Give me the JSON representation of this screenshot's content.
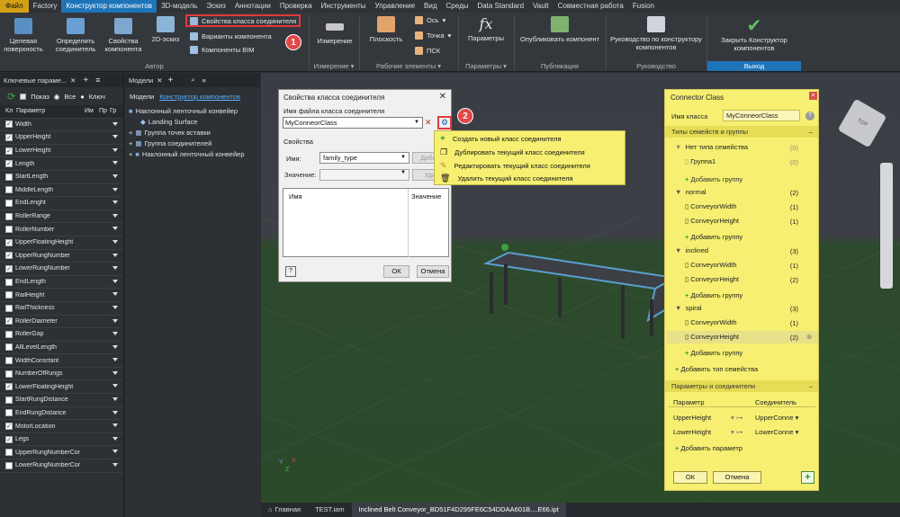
{
  "menubar": {
    "items": [
      "Файл",
      "Factory",
      "Конструктор компонентов",
      "3D-модель",
      "Эскиз",
      "Аннотации",
      "Проверка",
      "Инструменты",
      "Управление",
      "Вид",
      "Среды",
      "Data Standard",
      "Vault",
      "Совместная работа",
      "Fusion"
    ]
  },
  "ribbon": {
    "btn_surface": "Целевая поверхность",
    "btn_define": "Определить соединитель",
    "btn_props": "Свойства компонента",
    "btn_2d": "2D-эскиз",
    "small_connector_props": "Свойства класса соединителя",
    "small_variants": "Варианты компонента",
    "small_bim": "Компоненты BIM",
    "group_author": "Автор",
    "btn_measure": "Измерение",
    "group_measure": "Измерение",
    "btn_plane": "Плоскость",
    "small_axis": "Ось",
    "small_point": "Точка",
    "small_ucs": "ПСК",
    "group_work": "Рабочие элементы",
    "btn_params": "Параметры",
    "group_params": "Параметры",
    "btn_publish": "Опубликовать компонент",
    "group_publish": "Публикация",
    "btn_guide": "Руководство по конструктору компонентов",
    "group_guide": "Руководство",
    "btn_close": "Закрыть Конструктор компонентов",
    "group_exit": "Выход",
    "badge1": "1"
  },
  "left_panel": {
    "title": "Ключевые параме...",
    "show_label": "Показ",
    "radio_all": "Все",
    "radio_key": "Ключ",
    "col_kl": "Кл",
    "col_param": "Параметр",
    "col_im": "Им",
    "col_pr": "Пр",
    "col_gr": "Гр",
    "rows": [
      {
        "name": "Width",
        "checked": true
      },
      {
        "name": "UpperHeight",
        "checked": true
      },
      {
        "name": "LowerHeight",
        "checked": true
      },
      {
        "name": "Length",
        "checked": true
      },
      {
        "name": "StartLength",
        "checked": false
      },
      {
        "name": "MiddleLength",
        "checked": false
      },
      {
        "name": "EndLenght",
        "checked": false
      },
      {
        "name": "RollerRange",
        "checked": false
      },
      {
        "name": "RollerNumber",
        "checked": false
      },
      {
        "name": "UpperFloatingHeight",
        "checked": true
      },
      {
        "name": "UpperRungNumber",
        "checked": true
      },
      {
        "name": "LowerRungNumber",
        "checked": true
      },
      {
        "name": "EndLength",
        "checked": false
      },
      {
        "name": "RailHeight",
        "checked": false
      },
      {
        "name": "RailThickness",
        "checked": false
      },
      {
        "name": "RollerDiameter",
        "checked": true
      },
      {
        "name": "RollerGap",
        "checked": false
      },
      {
        "name": "AllLevelLength",
        "checked": false
      },
      {
        "name": "WidthConsrtant",
        "checked": false
      },
      {
        "name": "NumberOfRungs",
        "checked": false
      },
      {
        "name": "LowerFloatingHeight",
        "checked": true
      },
      {
        "name": "StartRungDistance",
        "checked": false
      },
      {
        "name": "EndRungDistance",
        "checked": false
      },
      {
        "name": "MotorLocation",
        "checked": true
      },
      {
        "name": "Legs",
        "checked": true
      },
      {
        "name": "UpperRungNumberCor",
        "checked": false
      },
      {
        "name": "LowerRungNumberCor",
        "checked": false
      }
    ]
  },
  "browser": {
    "tab_model": "Модели",
    "tab_designer": "Конструктор компонентов",
    "root": "Наклонный ленточный конвейер",
    "n1": "Landing Surface",
    "n2": "Группа точек вставки",
    "n3": "Группа соединителей",
    "n4": "Наклонный ленточный конвейер"
  },
  "dialog": {
    "title": "Свойства класса соединителя",
    "file_label": "Имя файла класса соединителя",
    "file_value": "MyConneorClass",
    "props_label": "Свойства",
    "name_label": "Имя:",
    "name_value": "family_type",
    "value_label": "Значение:",
    "add_btn": "Добави",
    "del_btn": "Удал",
    "col_name": "Имя",
    "col_value": "Значение",
    "ok": "ОК",
    "cancel": "Отмена",
    "badge2": "2"
  },
  "popup": {
    "items": [
      "Создать новый класс соединителя",
      "Дублировать текущий класс соединителя",
      "Редактировать текущий класс соединителя",
      "Удалить текущий класс соединителя"
    ]
  },
  "connector": {
    "title": "Connector Class",
    "class_label": "Имя класса",
    "class_value": "MyConneorClass",
    "sec_types": "Типы семейств и группы",
    "no_type": "Нет типа семейства",
    "no_type_count": "(0)",
    "group1": "Группа1",
    "group1_count": "(0)",
    "add_group": "Добавить группу",
    "normal": "normal",
    "normal_count": "(2)",
    "n_cw": "ConveyorWidth",
    "n_cw_count": "(1)",
    "n_ch": "ConveyorHeight",
    "n_ch_count": "(1)",
    "inclined": "inclined",
    "inclined_count": "(3)",
    "i_cw": "ConveyorWidth",
    "i_cw_count": "(1)",
    "i_ch": "ConveyorHeight",
    "i_ch_count": "(2)",
    "spiral": "spiral",
    "spiral_count": "(3)",
    "s_cw": "ConveyorWidth",
    "s_cw_count": "(1)",
    "s_ch": "ConveyorHeight",
    "s_ch_count": "(2)",
    "add_family": "Добавить тип семейства",
    "sec_params": "Параметры и соединители",
    "col_param": "Параметр",
    "col_conn": "Соединитель",
    "p1": "UpperHeight",
    "p1c": "UpperConne",
    "p2": "LowerHeight",
    "p2c": "LowerConne",
    "add_param": "Добавить параметр",
    "ok": "ОК",
    "cancel": "Отмена"
  },
  "status": {
    "tabs": [
      "Главная",
      "TEST.iam",
      "Inclined Belt Conveyor_BD51F4D295FE6C54DDAA601B....E66.ipt"
    ]
  },
  "colors": {
    "accent": "#1e74b8",
    "highlight": "#f6ef72",
    "badge": "#e14848"
  }
}
